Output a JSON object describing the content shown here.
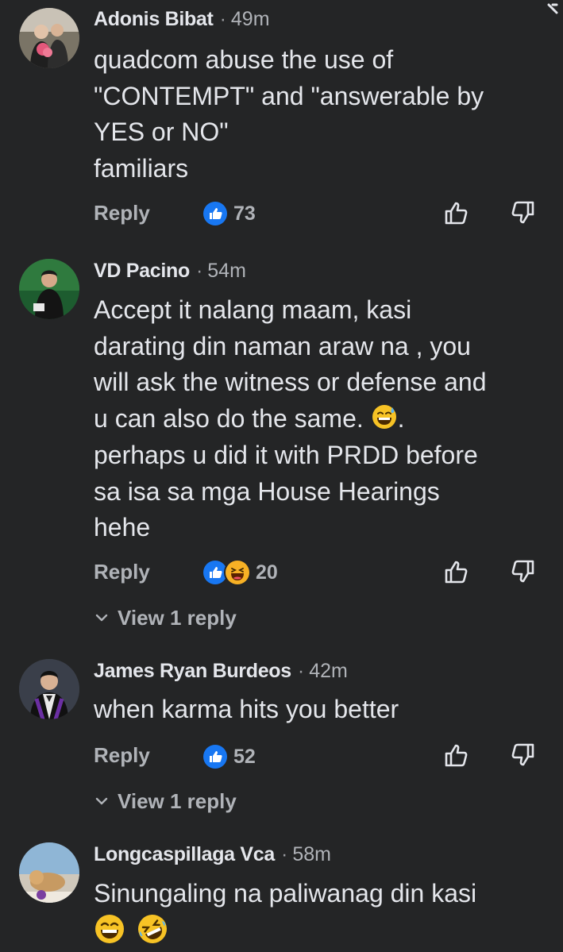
{
  "comments": [
    {
      "author": "Adonis Bibat",
      "time": "49m",
      "text": "quadcom abuse the use of\n\"CONTEMPT\" and \"answerable by\nYES or NO\"\nfamiliars",
      "reply_label": "Reply",
      "reactions": [
        "like-icon"
      ],
      "reaction_count": "73"
    },
    {
      "author": "VD Pacino",
      "time": "54m",
      "text_parts": [
        "Accept it nalang maam, kasi\ndarating din naman araw na , you\nwill ask the witness or defense and\nu can also do the same. ",
        ".\nperhaps u did it with PRDD before\nsa isa sa mga House Hearings\nhehe"
      ],
      "inline_emoji": "grinning-sweat-emoji",
      "reply_label": "Reply",
      "reactions": [
        "like-icon",
        "haha-icon"
      ],
      "reaction_count": "20",
      "view_replies": "View 1 reply"
    },
    {
      "author": "James Ryan Burdeos",
      "time": "42m",
      "text": "when karma hits you better",
      "reply_label": "Reply",
      "reactions": [
        "like-icon"
      ],
      "reaction_count": "52",
      "view_replies": "View 1 reply"
    },
    {
      "author": "Longcaspillaga Vca",
      "time": "58m",
      "text": "Sinungaling na paliwanag din kasi",
      "trailing_emojis": [
        "grinning-squinting-emoji",
        "rolling-laughing-emoji"
      ]
    }
  ],
  "colors": {
    "background": "#242526",
    "primary_text": "#e4e6eb",
    "secondary_text": "#b0b3b8",
    "like_blue": "#1877f2",
    "haha_yellow": "#f7b125"
  }
}
